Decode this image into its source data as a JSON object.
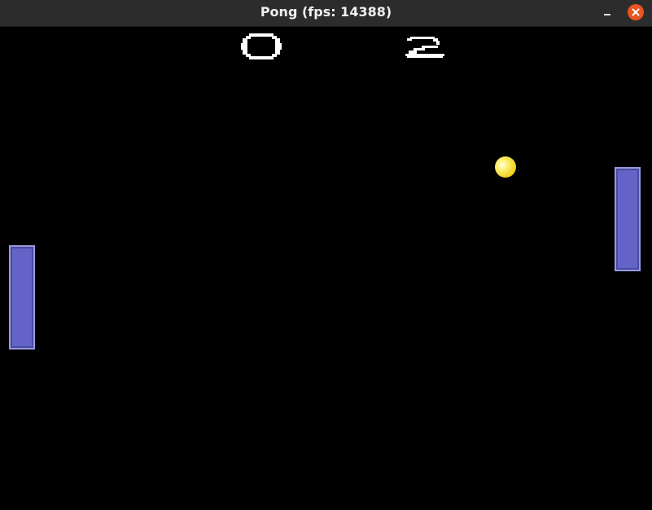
{
  "window": {
    "title": "Pong (fps: 14388)",
    "controls": {
      "minimize_icon": "minimize-icon",
      "close_icon": "close-icon",
      "close_color": "#e95420"
    }
  },
  "game": {
    "score_left": "0",
    "score_right": "2",
    "paddle_color": "#6464c8",
    "ball_color": "#f2d21a",
    "background_color": "#000000"
  }
}
